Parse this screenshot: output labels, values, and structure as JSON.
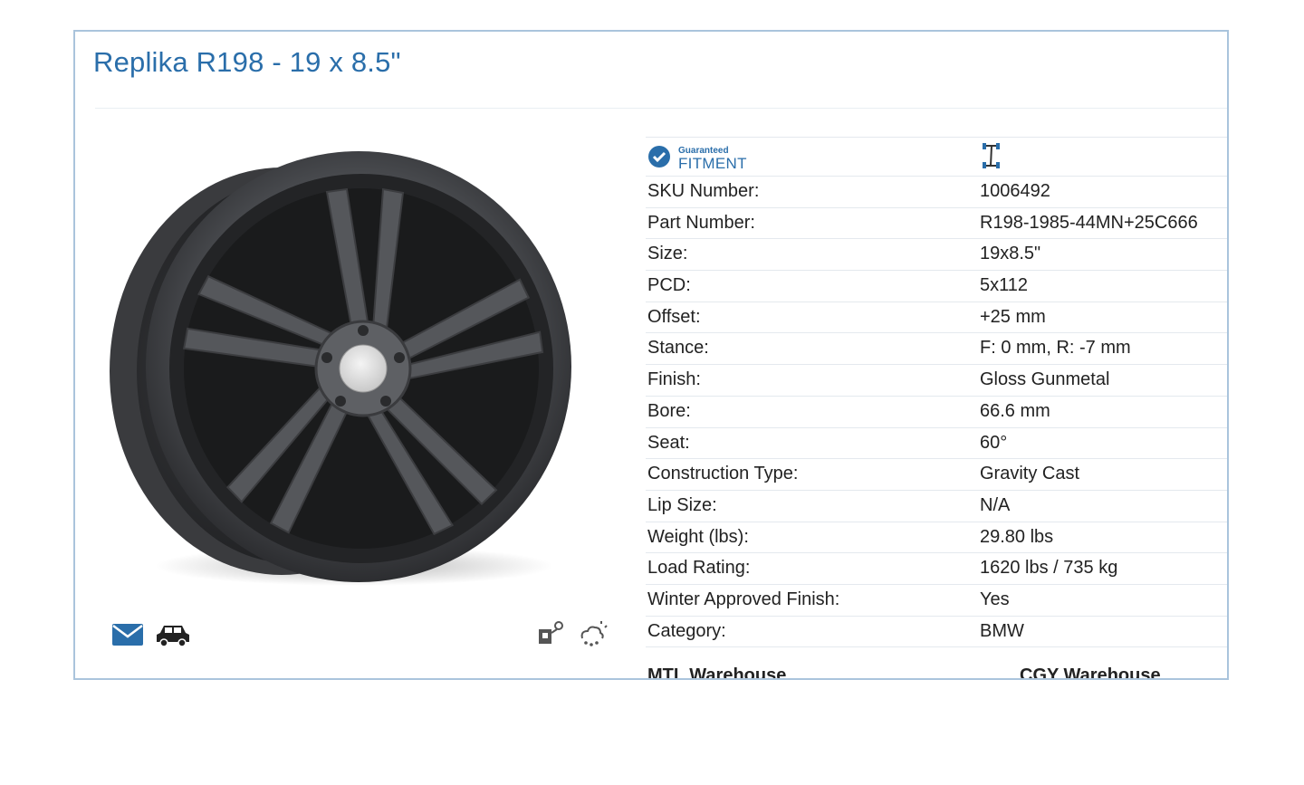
{
  "product": {
    "title": "Replika R198 - 19 x 8.5\""
  },
  "fitment": {
    "small": "Guaranteed",
    "big": "FITMENT"
  },
  "specs": [
    {
      "label": "SKU Number:",
      "value": "1006492"
    },
    {
      "label": "Part Number:",
      "value": "R198-1985-44MN+25C666"
    },
    {
      "label": "Size:",
      "value": "19x8.5\""
    },
    {
      "label": "PCD:",
      "value": "5x112"
    },
    {
      "label": "Offset:",
      "value": "+25 mm"
    },
    {
      "label": "Stance:",
      "value": "F: 0 mm, R: -7 mm"
    },
    {
      "label": "Finish:",
      "value": "Gloss Gunmetal"
    },
    {
      "label": "Bore:",
      "value": "66.6 mm"
    },
    {
      "label": "Seat:",
      "value": "60°"
    },
    {
      "label": "Construction Type:",
      "value": "Gravity Cast"
    },
    {
      "label": "Lip Size:",
      "value": "N/A"
    },
    {
      "label": "Weight (lbs):",
      "value": "29.80 lbs"
    },
    {
      "label": "Load Rating:",
      "value": "1620 lbs / 735 kg"
    },
    {
      "label": "Winter Approved Finish:",
      "value": "Yes"
    },
    {
      "label": "Category:",
      "value": "BMW"
    }
  ],
  "warehouses": {
    "mtl": "MTL Warehouse",
    "cgy": "CGY Warehouse"
  },
  "icons": {
    "email": "envelope-icon",
    "car": "car-icon",
    "tpms": "tpms-sensor-icon",
    "winter": "winter-weather-icon",
    "fitment": "check-circle-icon",
    "stance": "stance-axle-icon"
  },
  "colors": {
    "accent": "#2a6eaa",
    "border": "#aac4dc",
    "wheel": "#4a4c50"
  }
}
